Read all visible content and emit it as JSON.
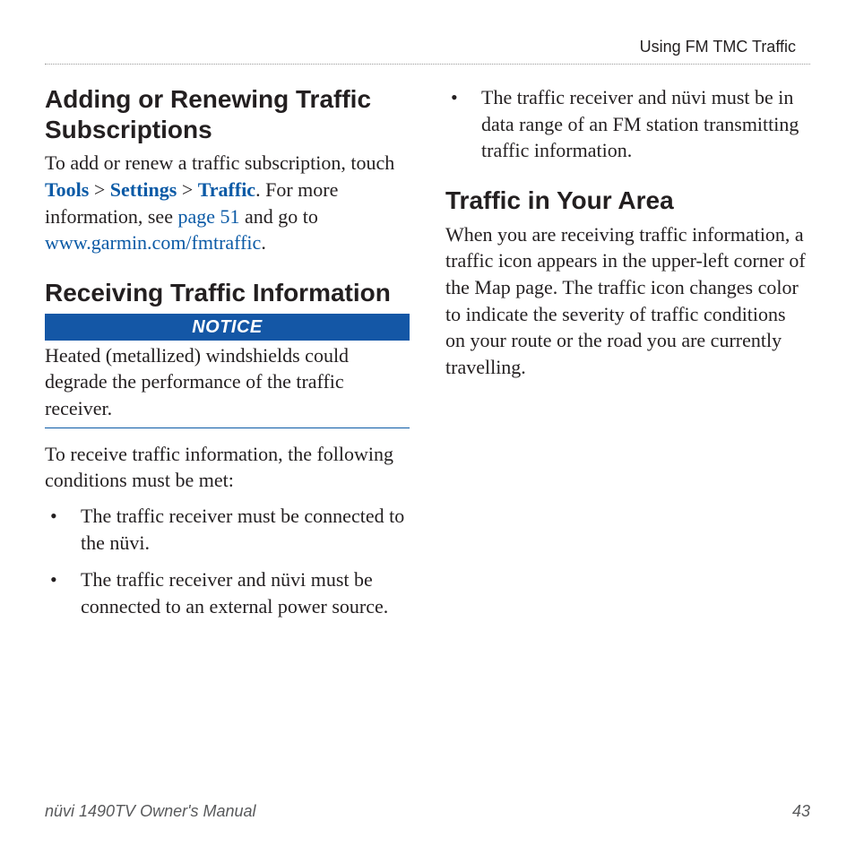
{
  "header": {
    "running_title": "Using FM TMC Traffic"
  },
  "left": {
    "h1": "Adding or Renewing Traffic Subscriptions",
    "p1_pre": "To add or renew a traffic subscription, touch ",
    "tools": "Tools",
    "gt1": " > ",
    "settings": "Settings",
    "gt2": " > ",
    "traffic": "Traffic",
    "p1_mid": ". For more information, see ",
    "page51": "page 51",
    "p1_mid2": " and go to ",
    "url": "www.garmin.com/fmtraffic",
    "p1_end": ".",
    "h2": "Receiving Traffic Information",
    "notice_label": "NOTICE",
    "notice_body": "Heated (metallized) windshields could degrade the performance of the traffic receiver.",
    "p2": "To receive traffic information, the following conditions must be met:",
    "bullets": [
      "The traffic receiver must be connected to the nüvi.",
      "The traffic receiver and nüvi must be connected to an external power source."
    ]
  },
  "right": {
    "bullets": [
      "The traffic receiver and nüvi must be in data range of an FM station transmitting traffic information."
    ],
    "h1": "Traffic in Your Area",
    "p1": "When you are receiving traffic information, a traffic icon appears in the upper-left corner of the Map page. The traffic icon changes color to indicate the severity of traffic conditions on your route or the road you are currently travelling."
  },
  "footer": {
    "left": "nüvi 1490TV Owner's Manual",
    "right": "43"
  }
}
